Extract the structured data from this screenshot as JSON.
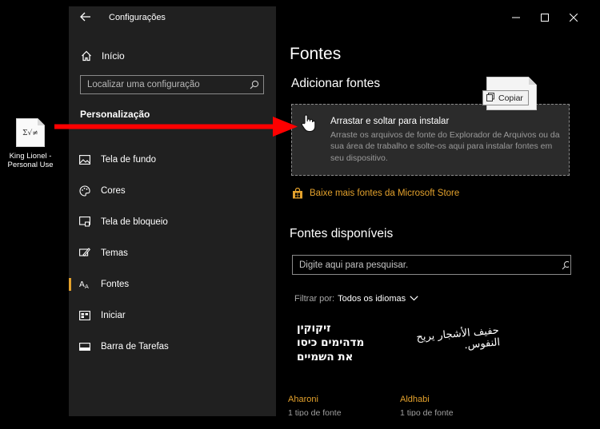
{
  "desktop": {
    "file_icon_text": "Σ√≠",
    "file_label_line1": "King Lionel -",
    "file_label_line2": "Personal Use"
  },
  "window": {
    "title": "Configurações",
    "controls": [
      "minimize-icon",
      "maximize-icon",
      "close-icon"
    ]
  },
  "sidebar": {
    "home_label": "Início",
    "search_placeholder": "Localizar uma configuração",
    "section_title": "Personalização",
    "items": [
      {
        "label": "Tela de fundo",
        "icon": "picture-icon"
      },
      {
        "label": "Cores",
        "icon": "palette-icon"
      },
      {
        "label": "Tela de bloqueio",
        "icon": "lock-screen-icon"
      },
      {
        "label": "Temas",
        "icon": "themes-icon"
      },
      {
        "label": "Fontes",
        "icon": "fonts-icon",
        "active": true
      },
      {
        "label": "Iniciar",
        "icon": "start-icon"
      },
      {
        "label": "Barra de Tarefas",
        "icon": "taskbar-icon"
      }
    ]
  },
  "main": {
    "page_title": "Fontes",
    "add_title": "Adicionar fontes",
    "drop_title": "Arrastar e soltar para instalar",
    "drop_desc": "Arraste os arquivos de fonte do Explorador de Arquivos ou da sua área de trabalho e solte-os aqui para instalar fontes em seu dispositivo.",
    "copy_label": "Copiar",
    "store_link": "Baixe mais fontes da Microsoft Store",
    "available_title": "Fontes disponíveis",
    "font_search_placeholder": "Digite aqui para pesquisar.",
    "filter_label": "Filtrar por:",
    "filter_value": "Todos os idiomas",
    "fonts": [
      {
        "preview": "זיקוקין מדהימים כיסו את השמיים",
        "name": "Aharoni",
        "count": "1 tipo de fonte"
      },
      {
        "preview": "حفيف الأشجار يريح النفوس.",
        "name": "Aldhabi",
        "count": "1 tipo de fonte"
      }
    ]
  },
  "colors": {
    "accent": "#e3a12c",
    "sidebar_bg": "#202020",
    "drop_zone_bg": "#2b2b2b",
    "arrow": "#ff0000"
  }
}
